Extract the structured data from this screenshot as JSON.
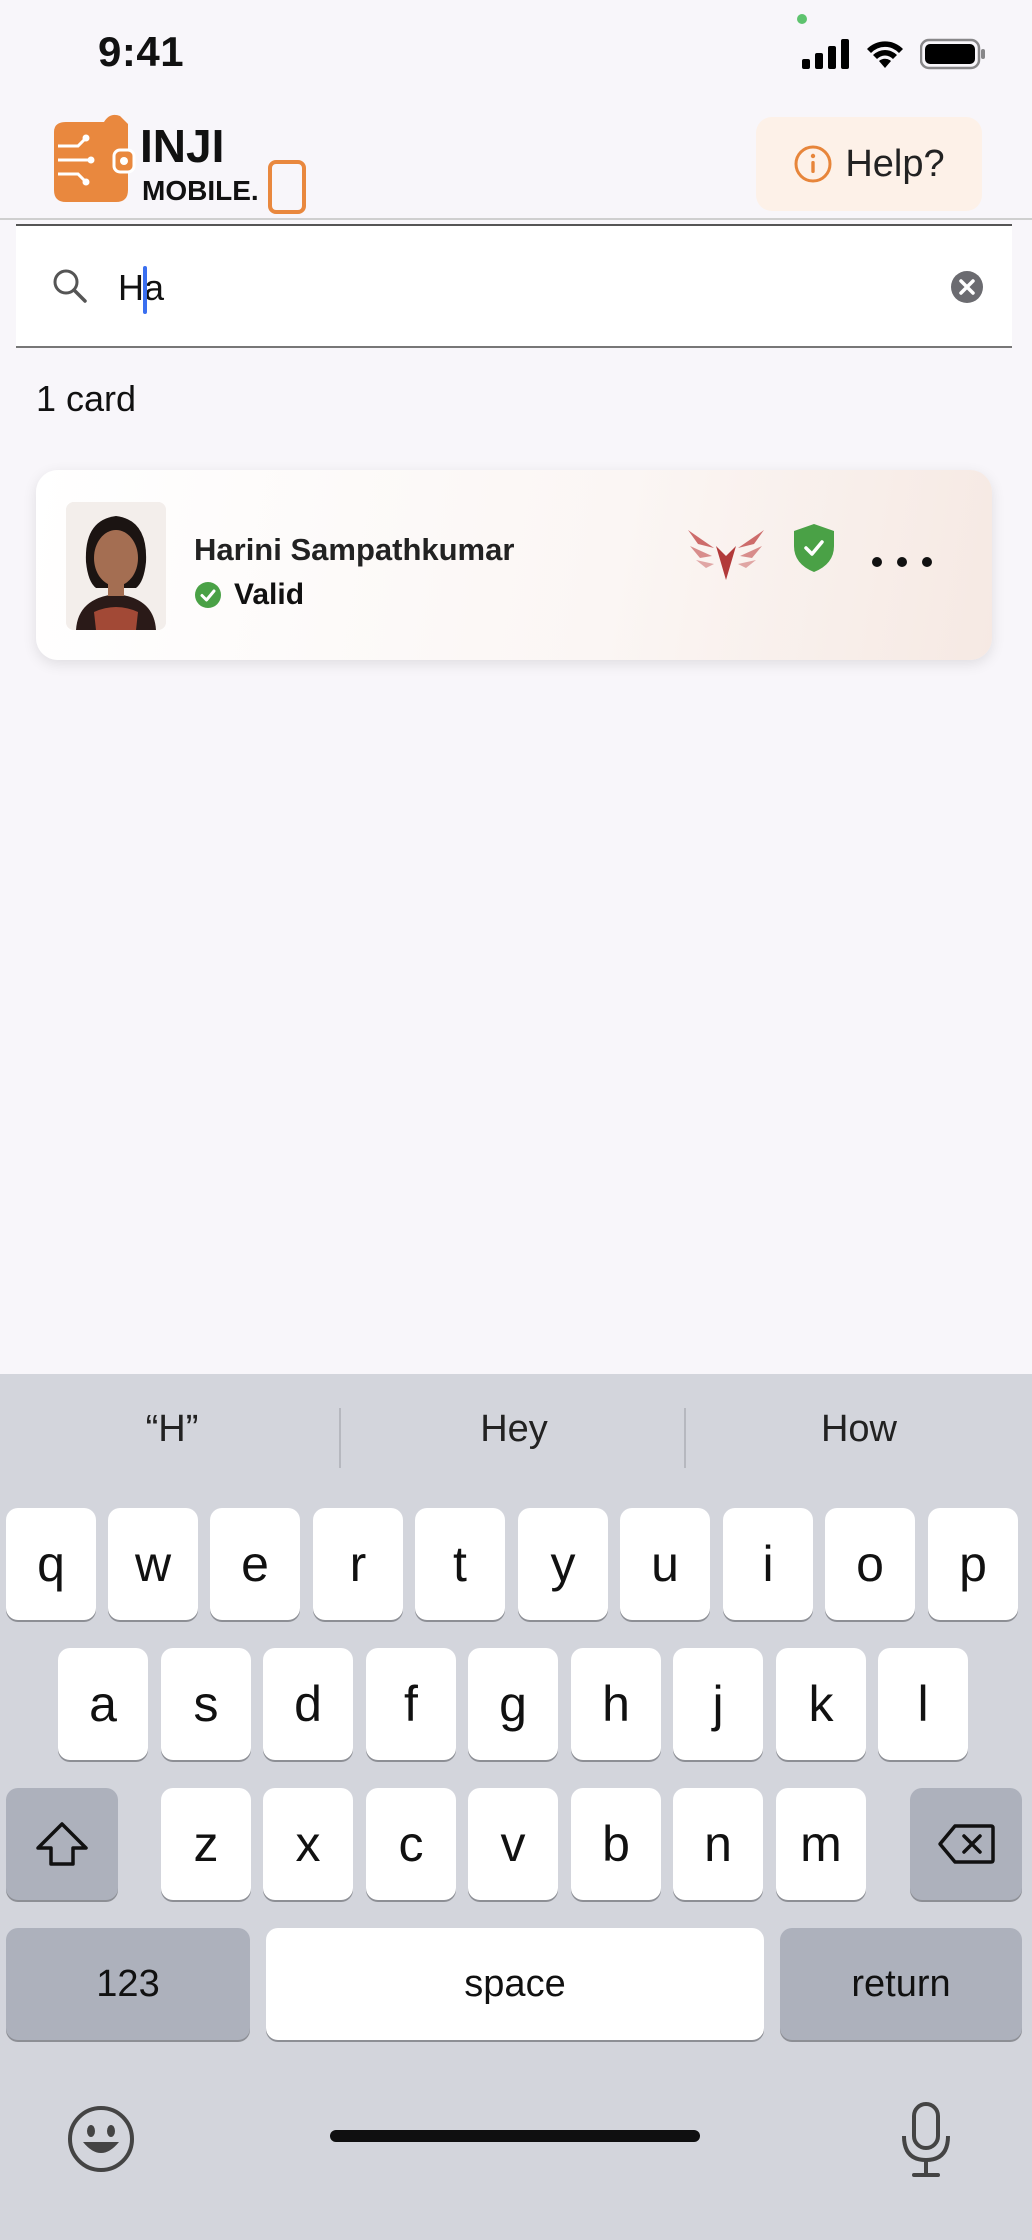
{
  "status_bar": {
    "time": "9:41"
  },
  "header": {
    "logo_line1": "INJI",
    "logo_line2": "MOBILE.",
    "help_label": "Help?"
  },
  "search": {
    "value": "Ha"
  },
  "results": {
    "count_label": "1 card"
  },
  "card": {
    "name": "Harini Sampathkumar",
    "status": "Valid"
  },
  "keyboard": {
    "suggestions": [
      "“H”",
      "Hey",
      "How"
    ],
    "row1": [
      "q",
      "w",
      "e",
      "r",
      "t",
      "y",
      "u",
      "i",
      "o",
      "p"
    ],
    "row2": [
      "a",
      "s",
      "d",
      "f",
      "g",
      "h",
      "j",
      "k",
      "l"
    ],
    "row3": [
      "z",
      "x",
      "c",
      "v",
      "b",
      "n",
      "m"
    ],
    "numbers_label": "123",
    "space_label": "space",
    "return_label": "return"
  },
  "colors": {
    "accent_orange": "#e7853a",
    "valid_green": "#4aa146",
    "cursor_blue": "#3a6ff0"
  }
}
